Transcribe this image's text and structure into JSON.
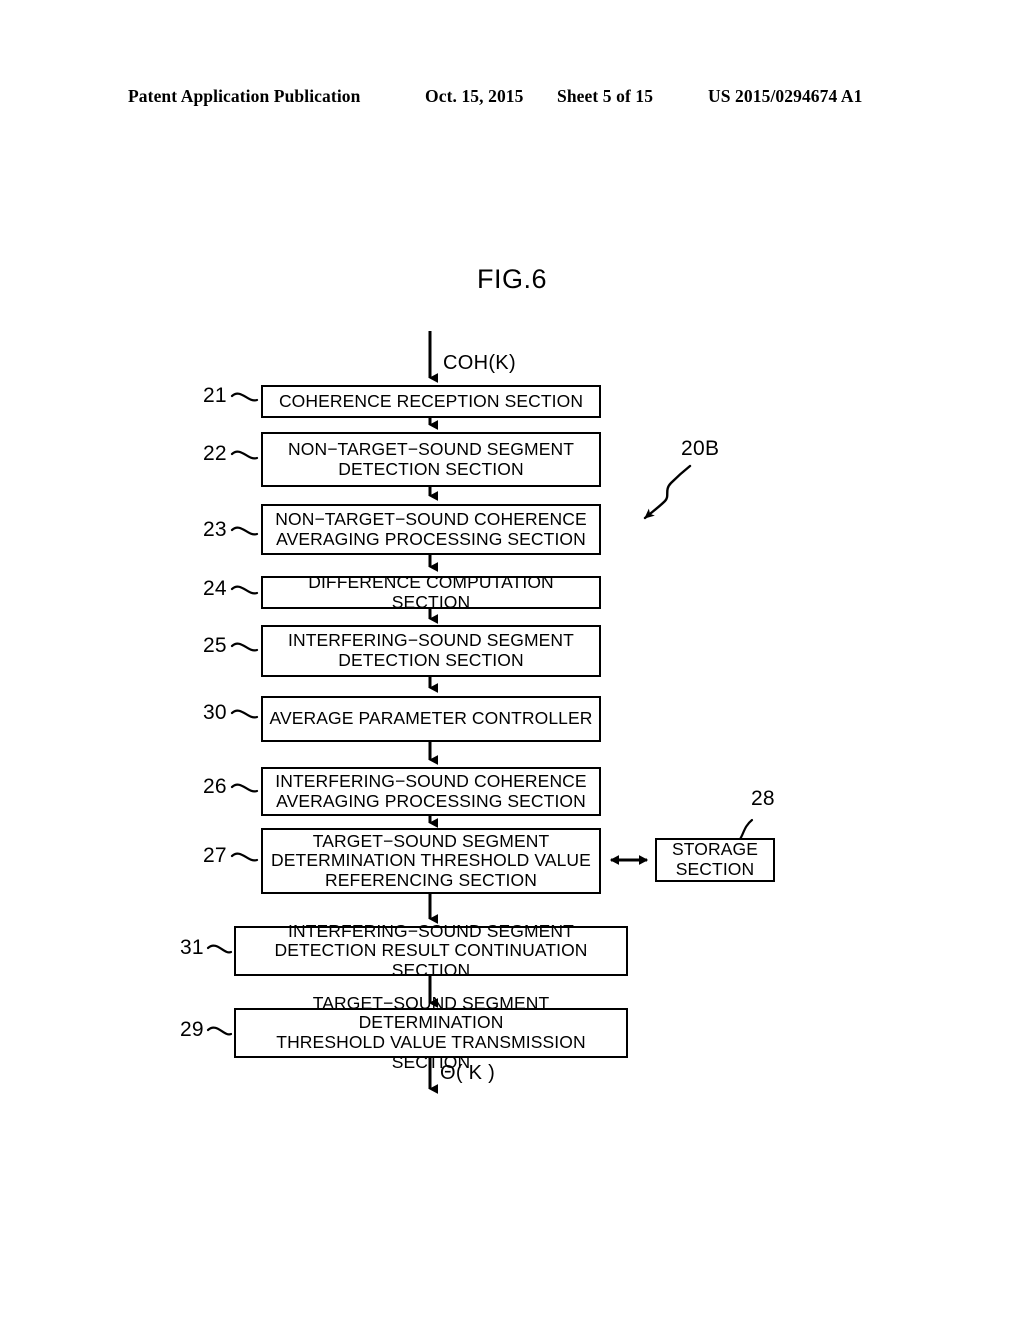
{
  "header": {
    "publication": "Patent Application Publication",
    "date": "Oct. 15, 2015",
    "sheet": "Sheet 5 of 15",
    "number": "US 2015/0294674 A1"
  },
  "figure": {
    "title": "FIG.6",
    "assembly_label": "20B",
    "input_signal": "COH(K)",
    "output_signal": "Θ( K )"
  },
  "blocks": [
    {
      "ref": "21",
      "label": "COHERENCE RECEPTION SECTION"
    },
    {
      "ref": "22",
      "label": "NON−TARGET−SOUND SEGMENT\nDETECTION SECTION"
    },
    {
      "ref": "23",
      "label": "NON−TARGET−SOUND COHERENCE\nAVERAGING PROCESSING  SECTION"
    },
    {
      "ref": "24",
      "label": "DIFFERENCE COMPUTATION SECTION"
    },
    {
      "ref": "25",
      "label": "INTERFERING−SOUND SEGMENT\nDETECTION SECTION"
    },
    {
      "ref": "30",
      "label": "AVERAGE PARAMETER CONTROLLER"
    },
    {
      "ref": "26",
      "label": "INTERFERING−SOUND COHERENCE\nAVERAGING PROCESSING  SECTION"
    },
    {
      "ref": "27",
      "label": "TARGET−SOUND SEGMENT\nDETERMINATION THRESHOLD VALUE\nREFERENCING SECTION"
    },
    {
      "ref": "31",
      "label": "INTERFERING−SOUND SEGMENT\nDETECTION RESULT CONTINUATION SECTION"
    },
    {
      "ref": "29",
      "label": "TARGET−SOUND SEGMENT DETERMINATION\nTHRESHOLD VALUE  TRANSMISSION SECTION"
    }
  ],
  "storage": {
    "ref": "28",
    "label": "STORAGE\nSECTION"
  },
  "colors": {
    "ink": "#000000",
    "paper": "#ffffff"
  }
}
